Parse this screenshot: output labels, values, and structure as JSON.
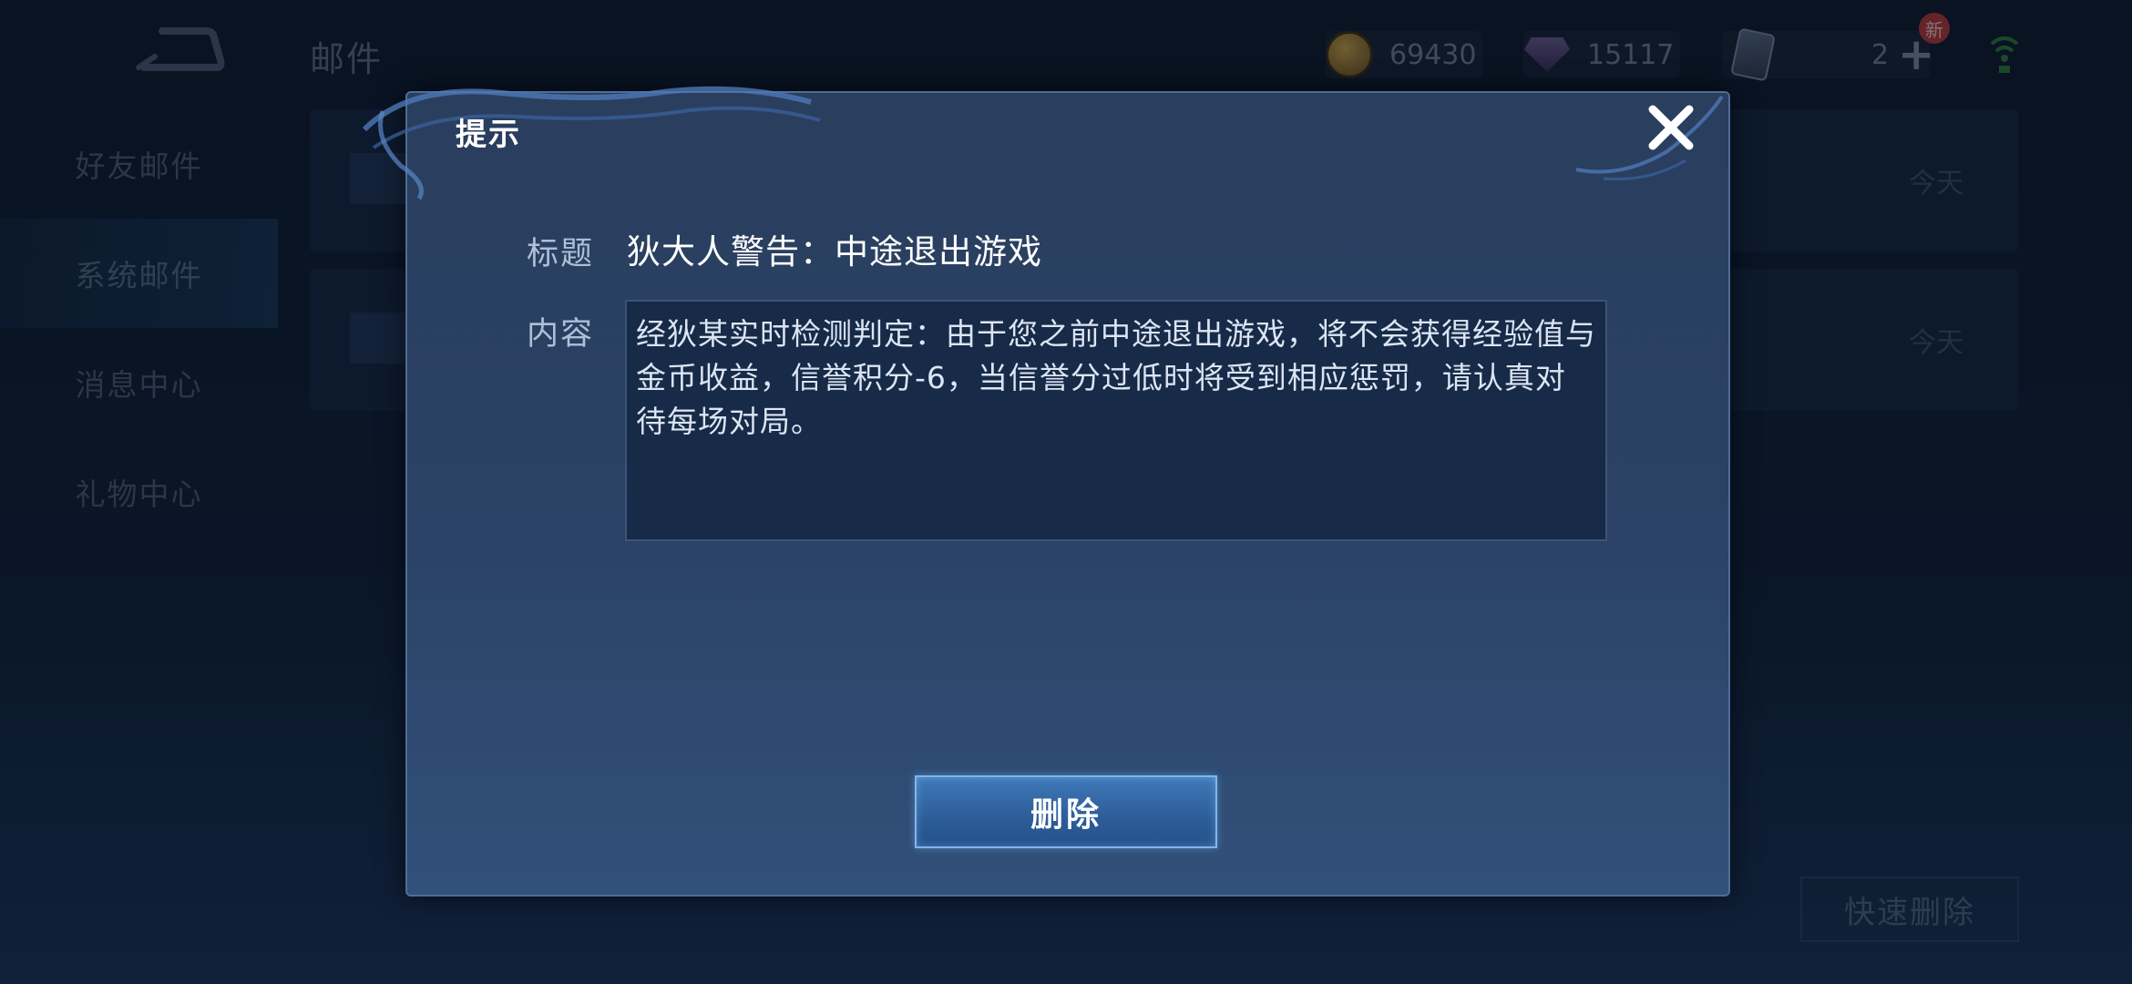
{
  "header": {
    "title": "邮件",
    "gold": "69430",
    "diamonds": "15117",
    "vouchers": "2",
    "new_badge": "新"
  },
  "sidebar": {
    "items": [
      {
        "label": "好友邮件"
      },
      {
        "label": "系统邮件"
      },
      {
        "label": "消息中心"
      },
      {
        "label": "礼物中心"
      }
    ],
    "active_index": 1
  },
  "mail_list": {
    "rows": [
      {
        "date": "今天"
      },
      {
        "date": "今天"
      }
    ],
    "quick_delete_label": "快速删除"
  },
  "dialog": {
    "title": "提示",
    "subject_label": "标题",
    "subject": "狄大人警告：中途退出游戏",
    "content_label": "内容",
    "content": "经狄某实时检测判定：由于您之前中途退出游戏，将不会获得经验值与金币收益，信誉积分-6，当信誉分过低时将受到相应惩罚，请认真对待每场对局。",
    "delete_label": "删除"
  },
  "colors": {
    "dialog_bg": "#2b4266",
    "button_bg": "#2d5d98",
    "button_border": "#7fb6ec"
  }
}
